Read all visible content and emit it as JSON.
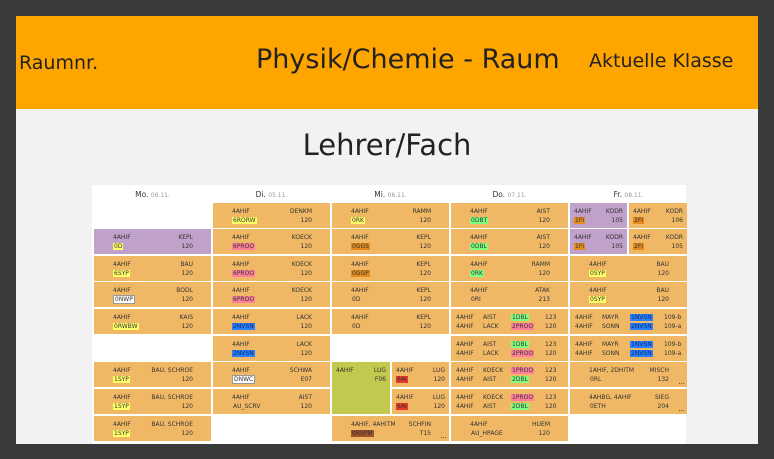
{
  "header": {
    "room_label": "Raumnr.",
    "title": "Physik/Chemie - Raum",
    "class_label": "Aktuelle Klasse"
  },
  "subtitle": "Lehrer/Fach",
  "days": [
    {
      "name": "Mo.",
      "date": "06.11."
    },
    {
      "name": "Di.",
      "date": "05.11."
    },
    {
      "name": "Mi.",
      "date": "06.11."
    },
    {
      "name": "Do.",
      "date": "07.11."
    },
    {
      "name": "Fr.",
      "date": "08.11."
    }
  ],
  "more_marker": "...",
  "colors": {
    "header": "#ffa500",
    "lesson": "#f0b864",
    "lesson_purple": "#bfa1c9",
    "lesson_green": "#c3c94e",
    "tag_yellow": "#ffff66",
    "tag_pink": "#ff7f9a",
    "tag_blue": "#2a7fff",
    "tag_green": "#7fff7f",
    "tag_orange": "#e58b1e",
    "tag_red": "#e83a2a",
    "tag_brown": "#a0522d"
  },
  "cells": {
    "mo2": {
      "class": "4AHIF",
      "teacher": "KEPL",
      "subject": "0D",
      "room": "120"
    },
    "mo3": {
      "class": "4AHIF",
      "teacher": "BAU",
      "subject": "6SYP",
      "room": "120"
    },
    "mo4": {
      "class": "4AHIF",
      "teacher": "BODL",
      "subject": "0NWP",
      "room": "120"
    },
    "mo5": {
      "class": "4AHIF",
      "teacher": "KAIS",
      "subject": "0RWBW",
      "room": "120"
    },
    "mo7": {
      "class": "4AHIF",
      "teacher": "BAU, SCHROE",
      "subject": "1SYP",
      "room": "120"
    },
    "mo8": {
      "class": "4AHIF",
      "teacher": "BAU, SCHROE",
      "subject": "1SYP",
      "room": "120"
    },
    "mo9": {
      "class": "4AHIF",
      "teacher": "BAU, SCHROE",
      "subject": "1SYP",
      "room": "120"
    },
    "di1": {
      "class": "4AHIF",
      "teacher": "DENKM",
      "subject": "6RORW",
      "room": "120"
    },
    "di2": {
      "class": "4AHIF",
      "teacher": "KOECK",
      "subject": "6PROO",
      "room": "120"
    },
    "di3": {
      "class": "4AHIF",
      "teacher": "KOECK",
      "subject": "6PROO",
      "room": "120"
    },
    "di4": {
      "class": "4AHIF",
      "teacher": "KOECK",
      "subject": "6PROO",
      "room": "120"
    },
    "di5": {
      "class": "4AHIF",
      "teacher": "LACK",
      "subject": "2NVSN",
      "room": "120"
    },
    "di6": {
      "class": "4AHIF",
      "teacher": "LACK",
      "subject": "2NVSN",
      "room": "120"
    },
    "di7": {
      "class": "4AHIF",
      "teacher": "SCHWA",
      "subject": "DNWC",
      "room": "E07"
    },
    "di8": {
      "class": "4AHIF",
      "teacher": "AIST",
      "subject": "AU_SCRV",
      "room": "120"
    },
    "mi1": {
      "class": "4AHIF",
      "teacher": "RAMM",
      "subject": "0RK",
      "room": "120"
    },
    "mi2": {
      "class": "4AHIF",
      "teacher": "KEPL",
      "subject": "0GGS",
      "room": "120"
    },
    "mi3": {
      "class": "4AHIF",
      "teacher": "KEPL",
      "subject": "0GGP",
      "room": "120"
    },
    "mi4": {
      "class": "4AHIF",
      "teacher": "KEPL",
      "subject": "0D",
      "room": "120"
    },
    "mi5": {
      "class": "4AHIF",
      "teacher": "KEPL",
      "subject": "0D",
      "room": "120"
    },
    "mi7a": {
      "class": "4AHIF",
      "teacher": "LUG",
      "room": "F06"
    },
    "mi7b": {
      "class": "4AHIF",
      "teacher": "LUG",
      "subject": "6AI",
      "room": "120"
    },
    "mi8b": {
      "class": "4AHIF",
      "teacher": "LUG",
      "subject": "6AI",
      "room": "120"
    },
    "mi9": {
      "class": "4AHIF, 4AHITM",
      "teacher": "SCHFIN",
      "subject": "0RSPM",
      "room": "T15"
    },
    "do1": {
      "class": "4AHIF",
      "teacher": "AIST",
      "subject": "0DBT",
      "room": "120"
    },
    "do2": {
      "class": "4AHIF",
      "teacher": "AIST",
      "subject": "0DBL",
      "room": "120"
    },
    "do3": {
      "class": "4AHIF",
      "teacher": "RAMM",
      "subject": "0RK",
      "room": "120"
    },
    "do4": {
      "class": "4AHIF",
      "teacher": "ATAK",
      "subject": "0RI",
      "room": "213"
    },
    "do5": {
      "rows": [
        {
          "class": "4AHIF",
          "teacher": "AIST",
          "subject": "1DBL",
          "room": "123"
        },
        {
          "class": "4AHIF",
          "teacher": "LACK",
          "subject": "2PROO",
          "room": "120"
        }
      ]
    },
    "do6": {
      "rows": [
        {
          "class": "4AHIF",
          "teacher": "AIST",
          "subject": "1DBL",
          "room": "123"
        },
        {
          "class": "4AHIF",
          "teacher": "LACK",
          "subject": "2PROO",
          "room": "120"
        }
      ]
    },
    "do7": {
      "rows": [
        {
          "class": "4AHIF",
          "teacher": "KOECK",
          "subject": "1PROO",
          "room": "123"
        },
        {
          "class": "4AHIF",
          "teacher": "AIST",
          "subject": "2DBL",
          "room": "120"
        }
      ]
    },
    "do8": {
      "rows": [
        {
          "class": "4AHIF",
          "teacher": "KOECK",
          "subject": "1PROO",
          "room": "123"
        },
        {
          "class": "4AHIF",
          "teacher": "AIST",
          "subject": "2DBL",
          "room": "120"
        }
      ]
    },
    "do9": {
      "class": "4AHIF",
      "teacher": "HUEM",
      "subject": "AU_HPAGE",
      "room": "120"
    },
    "fr1a": {
      "class": "4AHIF",
      "teacher": "KODR",
      "subject": "1FI",
      "room": "105"
    },
    "fr1b": {
      "class": "4AHIF",
      "teacher": "KODR",
      "subject": "2FI",
      "room": "106"
    },
    "fr2a": {
      "class": "4AHIF",
      "teacher": "KODR",
      "subject": "1FI",
      "room": "105"
    },
    "fr2b": {
      "class": "4AHIF",
      "teacher": "KODR",
      "subject": "2FI",
      "room": "105"
    },
    "fr3": {
      "class": "4AHIF",
      "teacher": "BAU",
      "subject": "0SYP",
      "room": "120"
    },
    "fr4": {
      "class": "4AHIF",
      "teacher": "BAU",
      "subject": "0SYP",
      "room": "120"
    },
    "fr5": {
      "rows": [
        {
          "class": "4AHIF",
          "teacher": "MAYR",
          "subject": "1NVSN",
          "room": "109-b"
        },
        {
          "class": "4AHIF",
          "teacher": "SONN",
          "subject": "2NVSN",
          "room": "109-a"
        }
      ]
    },
    "fr6": {
      "rows": [
        {
          "class": "4AHIF",
          "teacher": "MAYR",
          "subject": "1NVSN",
          "room": "109-b"
        },
        {
          "class": "4AHIF",
          "teacher": "SONN",
          "subject": "2NVSN",
          "room": "109-a"
        }
      ]
    },
    "fr7": {
      "class": "1AHIF, 2DHITM",
      "teacher": "MISCH",
      "subject": "0RL",
      "room": "132"
    },
    "fr8": {
      "class": "4AHBG, 4AHIF",
      "teacher": "SIEG",
      "subject": "0ETH",
      "room": "204"
    }
  }
}
